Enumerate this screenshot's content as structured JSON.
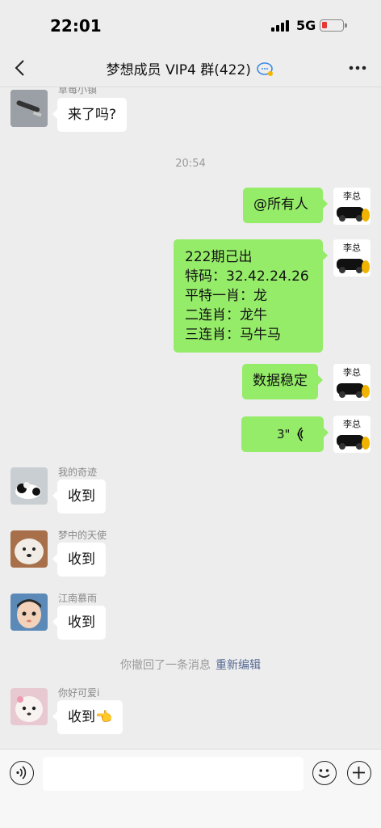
{
  "status_bar": {
    "time": "22:01",
    "network": "5G",
    "battery_color": "#e53935"
  },
  "nav": {
    "title": "梦想成员 VIP4 群(422)",
    "back_icon": "chevron-left-icon",
    "more_icon": "ellipsis-icon"
  },
  "messages": [
    {
      "sender": "草莓小镇",
      "text": "来了吗?"
    },
    {
      "timestamp": "20:54"
    },
    {
      "text": "@所有人"
    },
    {
      "text": "222期己出\n特码：32.42.24.26\n平特一肖：龙\n二连肖：龙牛\n三连肖：马牛马"
    },
    {
      "text": "数据稳定"
    },
    {
      "voice_duration": "3\""
    },
    {
      "sender": "我的奇迹",
      "text": "收到"
    },
    {
      "sender": "梦中的天使",
      "text": "收到"
    },
    {
      "sender": "江南慕雨",
      "text": "收到"
    },
    {
      "system": "你撤回了一条消息",
      "action": "重新编辑"
    },
    {
      "sender": "你好可爱i",
      "text": "收到",
      "emoji": "👈"
    }
  ],
  "self_avatar": {
    "label": "李总"
  },
  "input_bar": {
    "voice_icon": "voice-icon",
    "emoji_icon": "smiley-icon",
    "plus_icon": "plus-icon"
  },
  "colors": {
    "green_bubble": "#95ec69",
    "background": "#ededed",
    "link": "#576b95"
  }
}
